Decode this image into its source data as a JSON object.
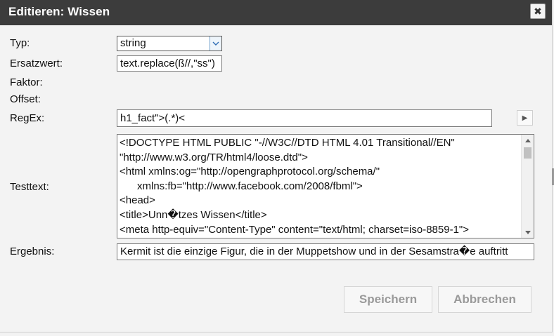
{
  "dialog": {
    "title": "Editieren: Wissen",
    "close_label": "✖"
  },
  "form": {
    "typ": {
      "label": "Typ:",
      "value": "string"
    },
    "ersatzwert": {
      "label": "Ersatzwert:",
      "value": "text.replace(ß//,\"ss\")"
    },
    "faktor": {
      "label": "Faktor:"
    },
    "offset": {
      "label": "Offset:"
    },
    "regex": {
      "label": "RegEx:",
      "value": "h1_fact\">(.*)<"
    },
    "testtext": {
      "label": "Testtext:",
      "lines": [
        "<!DOCTYPE HTML PUBLIC \"-//W3C//DTD HTML 4.01 Transitional//EN\"",
        "\"http://www.w3.org/TR/html4/loose.dtd\">",
        "<html xmlns:og=\"http://opengraphprotocol.org/schema/\"",
        "      xmlns:fb=\"http://www.facebook.com/2008/fbml\">",
        "<head>",
        "<title>Unn�tzes Wissen</title>",
        "<meta http-equiv=\"Content-Type\" content=\"text/html; charset=iso-8859-1\">"
      ]
    },
    "ergebnis": {
      "label": "Ergebnis:",
      "value": "Kermit ist die einzige Figur, die in der Muppetshow und in der Sesamstra�e auftritt"
    }
  },
  "buttons": {
    "save": "Speichern",
    "cancel": "Abbrechen"
  },
  "colors": {
    "titlebar": "#3c3c3c",
    "background": "#f3f3f3",
    "button_text_disabled": "#9a9a9a"
  }
}
